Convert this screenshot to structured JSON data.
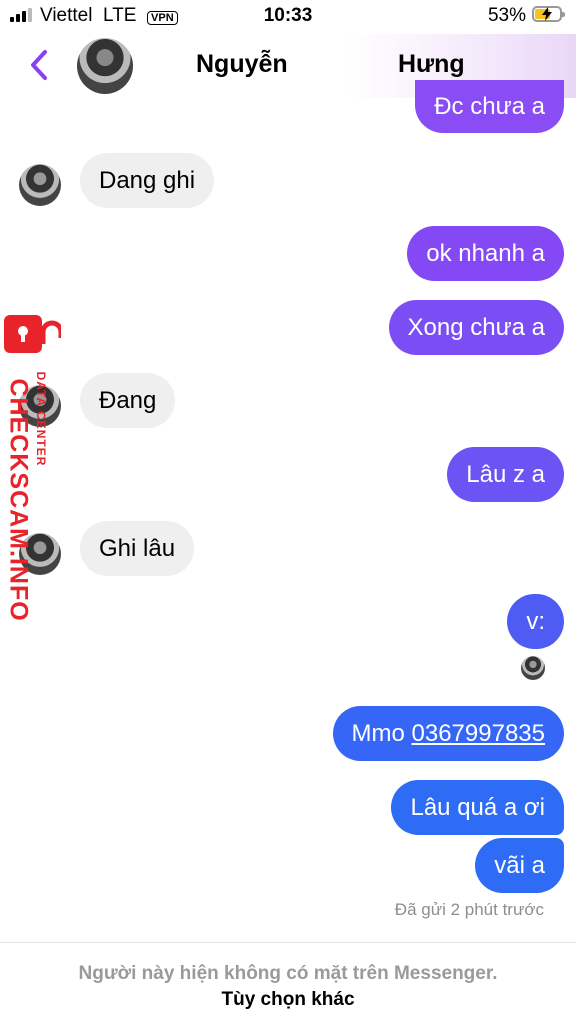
{
  "status_bar": {
    "carrier": "Viettel",
    "network": "LTE",
    "vpn": "VPN",
    "time": "10:33",
    "battery": "53%"
  },
  "header": {
    "name_first": "Nguyễn",
    "name_last": "Hưng"
  },
  "messages": [
    {
      "dir": "out",
      "text": "Đc chưa a"
    },
    {
      "dir": "in",
      "text": "Dang ghi"
    },
    {
      "dir": "out",
      "text": "ok nhanh a"
    },
    {
      "dir": "out",
      "text": "Xong chưa a"
    },
    {
      "dir": "in",
      "text": "Đang"
    },
    {
      "dir": "out",
      "text": "Lâu z a"
    },
    {
      "dir": "in",
      "text": "Ghi lâu"
    },
    {
      "dir": "out",
      "text": "v:"
    },
    {
      "dir": "out",
      "text": "Mmo ",
      "link": "0367997835"
    },
    {
      "dir": "out",
      "text": "Lâu quá a ơi"
    },
    {
      "dir": "out",
      "text": "vãi a"
    }
  ],
  "sent_status": "Đã gửi 2 phút trước",
  "footer": {
    "notice": "Người này hiện không có mặt trên Messenger.",
    "options": "Tùy chọn khác"
  },
  "watermark": {
    "main": "CHECKSCAM.INFO",
    "sub": "DATA CENTER"
  },
  "colors": {
    "bubble_purple": "#8a4cf4",
    "bubble_blue": "#2e6cf6",
    "back_arrow": "#8a3ff0",
    "watermark": "#e8232a"
  }
}
